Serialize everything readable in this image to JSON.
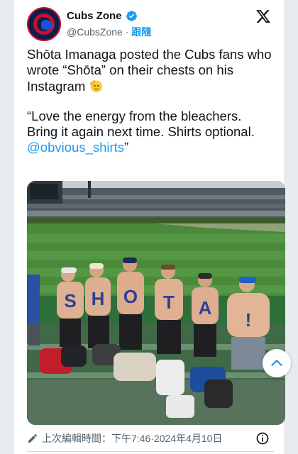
{
  "account": {
    "name": "Cubs Zone",
    "handle": "@CubsZone",
    "separator": " · ",
    "follow_label": "跟隨"
  },
  "tweet": {
    "paragraph1": "Shōta Imanaga posted the Cubs fans who wrote “Shōta” on their chests on his Instagram",
    "paragraph2_text": "“Love the energy from the bleachers. Bring it again next time. Shirts optional. ",
    "paragraph2_link": "@obvious_shirts",
    "paragraph2_end": "”"
  },
  "photo": {
    "chest_letters": [
      "S",
      "H",
      "O",
      "T",
      "A",
      "!"
    ]
  },
  "footer": {
    "edited_label": "上次編輯時間：",
    "time": "下午7:46",
    "separator": " · ",
    "date": "2024年4月10日"
  },
  "icons": {
    "verified": "verified-badge-icon",
    "x_logo": "x-logo-icon",
    "pencil": "pencil-icon",
    "info": "info-icon",
    "scroll_up": "chevron-up-icon"
  },
  "colors": {
    "accent": "#1d9bf0",
    "text": "#0f1419",
    "muted": "#536471",
    "cubs_blue": "#0b1f4b",
    "cubs_red": "#c8102e"
  }
}
